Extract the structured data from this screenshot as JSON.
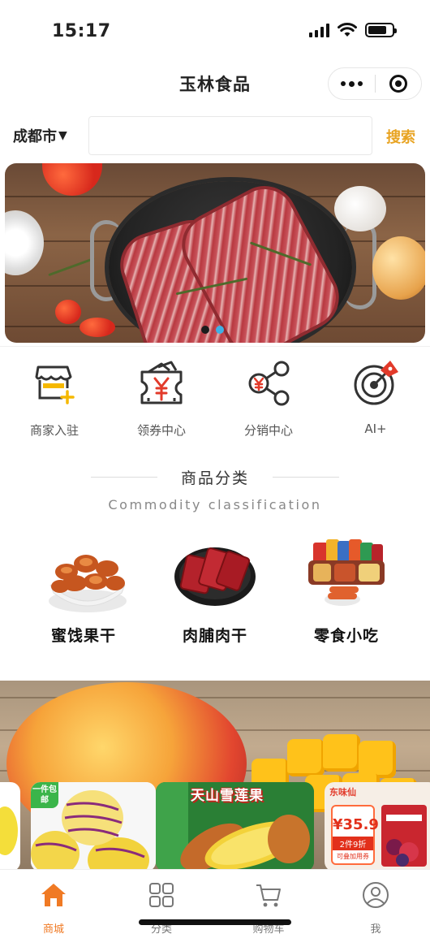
{
  "status_bar": {
    "time": "15:17",
    "icons": [
      "signal-icon",
      "wifi-icon",
      "battery-icon"
    ],
    "battery_level": 0.8
  },
  "nav": {
    "title": "玉林食品",
    "more_icon": "more-dots-icon",
    "close_icon": "target-close-icon"
  },
  "search": {
    "city": "成都市",
    "city_dropdown_icon": "triangle-down-icon",
    "placeholder": "",
    "button_label": "搜索"
  },
  "banner": {
    "pagination": {
      "count": 2,
      "active_index": 1
    }
  },
  "quick_entries": [
    {
      "label": "商家入驻",
      "icon": "storefront-plus-icon"
    },
    {
      "label": "领券中心",
      "icon": "coupon-yen-icon"
    },
    {
      "label": "分销中心",
      "icon": "share-yen-icon"
    },
    {
      "label": "AI+",
      "icon": "radar-target-icon"
    }
  ],
  "section": {
    "title_cn": "商品分类",
    "title_en": "Commodity classification"
  },
  "categories": [
    {
      "name": "蜜饯果干",
      "icon": "dried-apricots-image"
    },
    {
      "name": "肉脯肉干",
      "icon": "jerky-image"
    },
    {
      "name": "零食小吃",
      "icon": "snacks-image"
    }
  ],
  "promo_cards": [
    {
      "badge": "一件包邮",
      "title": ""
    },
    {
      "badge": "",
      "title": "天山雪莲果"
    },
    {
      "badge": "",
      "title": "",
      "brand": "东味仙",
      "price": "¥35.9",
      "discount": "2件9折",
      "note": "可叠加用券"
    }
  ],
  "tabbar": {
    "active": "商城",
    "items": [
      {
        "label": "商城",
        "icon": "home-icon"
      },
      {
        "label": "分类",
        "icon": "grid-icon"
      },
      {
        "label": "购物车",
        "icon": "cart-icon"
      },
      {
        "label": "我",
        "icon": "user-icon"
      }
    ]
  },
  "colors": {
    "accent": "#e8a321",
    "tab_active": "#f07a24",
    "dot_active": "#3fb1e6",
    "badge_green": "#3bb54a",
    "price_red": "#e2301b"
  }
}
